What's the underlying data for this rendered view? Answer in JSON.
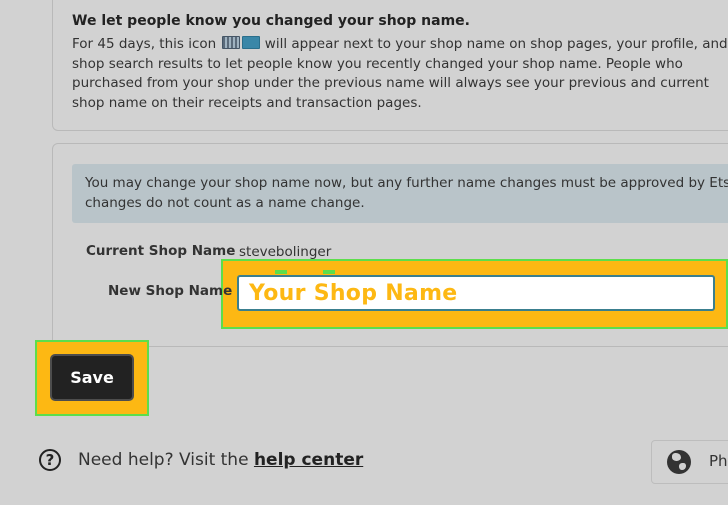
{
  "notice": {
    "title": "We let people know you changed your shop name.",
    "lines": [
      {
        "before": "For 45 days, this icon ",
        "after": " will appear next to your shop name on shop pages, your profile, and"
      },
      "shop search results to let people know you recently changed your shop name. People who",
      "purchased from your shop under the previous name will always see your previous and current",
      "shop name on their receipts and transaction pages."
    ]
  },
  "info_banner": {
    "lines": [
      "You may change your shop name now, but any further name changes must be approved by Ets",
      "changes do not count as a name change."
    ]
  },
  "form": {
    "current_label": "Current Shop Name",
    "current_value": "stevebolinger",
    "new_label": "New Shop Name",
    "new_value": "Your Shop Name"
  },
  "save_label": "Save",
  "footer": {
    "help_prefix": "Need help? Visit the ",
    "help_link": "help center",
    "lang_partial": "Ph"
  },
  "colors": {
    "highlight": "#fdb813",
    "highlight_border": "#5dde4c",
    "button_dark": "#222222",
    "page_bg": "#d2d2d2"
  }
}
